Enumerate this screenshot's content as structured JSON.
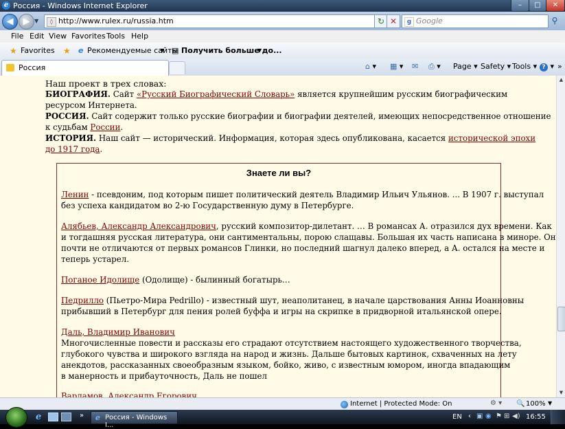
{
  "window": {
    "title": "Россия - Windows Internet Explorer",
    "icon": "ie-icon"
  },
  "address": {
    "url": "http://www.rulex.ru/russia.htm",
    "search_placeholder": "Google",
    "search_icon": "google-icon"
  },
  "menu": [
    "File",
    "Edit",
    "View",
    "Favorites",
    "Tools",
    "Help"
  ],
  "favorites_bar": {
    "favorites_label": "Favorites",
    "item1": "Рекомендуемые сайты",
    "item2": "Получить больше до..."
  },
  "tab": {
    "label": "Россия"
  },
  "command_bar": {
    "page": "Page",
    "safety": "Safety",
    "tools": "Tools"
  },
  "intro": {
    "heading": "Наш проект в трех словах:",
    "bio_label": "БИОГРАФИЯ.",
    "bio_text1": "Сайт",
    "bio_link": "«Русский Биографический Словарь»",
    "bio_text2": "является крупнейшим русским биографическим",
    "bio_text3": "ресурсом Интернета.",
    "russia_label": "РОССИЯ.",
    "russia_text1": "Сайт содержит только русские биографии и биографии деятелей, имеющих непосредственное отношение",
    "russia_text2": "к судьбам",
    "russia_link": "России",
    "russia_text3": ".",
    "history_label": "ИСТОРИЯ.",
    "history_text1": "Наш сайт — исторический. Информация, которая здесь опубликована, касается",
    "history_link1": "исторической эпохи",
    "history_link2": "до 1917 года",
    "history_text2": "."
  },
  "did_you_know": {
    "title": "Знаете ли вы?",
    "entries": [
      {
        "link": "Ленин",
        "lines": [
          "- псевдоним, под которым пишет политический деятель Владимир Ильич Ульянов. ... В 1907 г. выступал",
          "без успеха кандидатом во 2-ю Государственную думу в Петербурге."
        ]
      },
      {
        "link": "Алябьев, Александр Александрович",
        "lines": [
          ", русский композитор-дилетант. … В романсах А. отразился дух времени. Как",
          "и тогдашняя русская литература, они сантиментальны, порою слащавы. Большая их часть написана в миноре. Они",
          "почти не отличаются от первых романсов Глинки, но последний шагнул далеко вперед, а А. остался на месте и",
          "теперь устарел."
        ]
      },
      {
        "link": "Поганое Идолище",
        "lines": [
          "(Одолище) - былинный богатырь…"
        ]
      },
      {
        "link": "Педрилло",
        "lines": [
          "(Пьетро-Мира Pedrillo) - известный шут, неаполитанец, в начале царствования Анны Иоанновны",
          "прибывший в Петербург для пения ролей буффа и игры на скрипке в придворной итальянской опере."
        ]
      },
      {
        "link": "Даль, Владимир Иванович",
        "lines": [
          "Многочисленные повести и рассказы его страдают отсутствием настоящего художественного творчества,",
          "глубокого чувства и широкого взгляда на народ и жизнь. Дальше бытовых картинок, схваченных на лету",
          "анекдотов, рассказанных своеобразным языком, бойко, живо, с известным юмором, иногда впадающим",
          "в манерность и прибауточность, Даль не пошел"
        ]
      },
      {
        "link": "Варламов, Александр Егорович",
        "lines": []
      }
    ]
  },
  "status": {
    "zone": "Internet | Protected Mode: On",
    "zoom": "100%"
  },
  "taskbar": {
    "window_button": "Россия - Windows I...",
    "lang": "EN",
    "time": "16:55"
  }
}
